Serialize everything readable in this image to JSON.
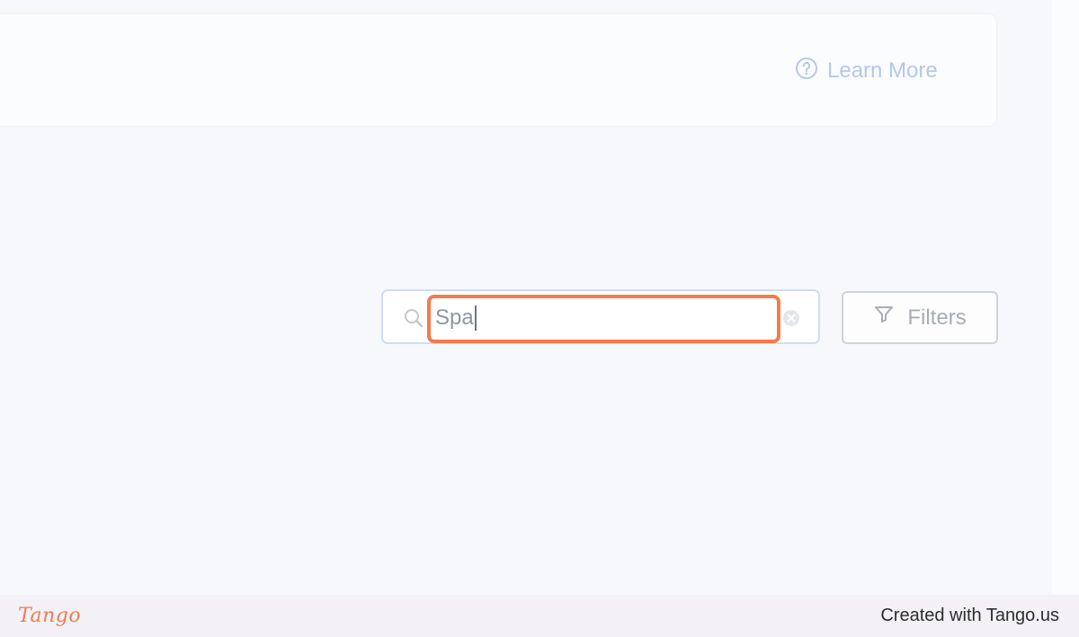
{
  "banner": {
    "learn_more_label": "Learn More",
    "help_icon": "question-circle-icon"
  },
  "search": {
    "value": "Spa",
    "search_icon": "search-icon",
    "clear_icon": "clear-icon"
  },
  "filters": {
    "label": "Filters",
    "icon": "funnel-icon"
  },
  "footer": {
    "logo_text": "Tango",
    "credit_text": "Created with Tango.us"
  },
  "colors": {
    "highlight": "#f47b4c",
    "link": "#b3c8ee",
    "search_border": "#cfdcf8"
  }
}
